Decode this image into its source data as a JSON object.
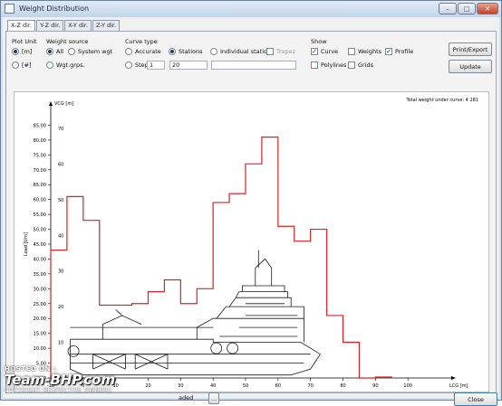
{
  "window": {
    "title": "Weight Distribution",
    "controls": [
      "–",
      "□",
      "✕"
    ]
  },
  "tabs": [
    "X-Z dir.",
    "Y-Z dir.",
    "X-Y dir.",
    "Z-Y dir."
  ],
  "plot_unit": {
    "title": "Plot Unit",
    "options": [
      "[m]",
      "[#]"
    ],
    "selected": "[m]"
  },
  "weight_source": {
    "title": "Weight source",
    "options": [
      "All",
      "System wgt",
      "Wgt.grps."
    ],
    "selected": "All"
  },
  "curve_type": {
    "title": "Curve type",
    "options": [
      "Accurate",
      "Stations",
      "Individual stations",
      "Tropez",
      "Step"
    ],
    "selected": "Stations",
    "step_value": "1",
    "stations_value": "20"
  },
  "show": {
    "title": "Show",
    "items": [
      {
        "label": "Curve",
        "checked": true
      },
      {
        "label": "Weights",
        "checked": false
      },
      {
        "label": "Profile",
        "checked": true
      },
      {
        "label": "Polylines",
        "checked": false
      },
      {
        "label": "Grids",
        "checked": false
      }
    ]
  },
  "buttons": {
    "print_export": "Print/Export",
    "update": "Update",
    "close": "Close",
    "ellipsis": "..."
  },
  "bottom": {
    "status_text": "aded"
  },
  "watermark": {
    "line1": "HOSTED ON :",
    "line2": "Team-BHP.com",
    "line3": "COPYRIGHT RESPECTIVE OWNERS"
  },
  "chart_data": {
    "type": "step-line",
    "total_text": "Total weight under curve: 4 281",
    "ylabel_top": "VCG [m]",
    "ylabel_left": "Load [t/m]",
    "xlabel": "LCG [m]",
    "xlim": [
      -10,
      110
    ],
    "ylim": [
      0,
      90
    ],
    "x_ticks": [
      "-10",
      "0",
      "10",
      "20",
      "30",
      "40",
      "50",
      "60",
      "70",
      "80",
      "90",
      "100"
    ],
    "y_ticks": [
      "0.00",
      "5.00",
      "10.00",
      "15.00",
      "20.00",
      "25.00",
      "30.00",
      "35.00",
      "40.00",
      "45.00",
      "50.00",
      "55.00",
      "60.00",
      "65.00",
      "70.00",
      "75.00",
      "80.00",
      "85.00"
    ],
    "vcg_ticks": [
      "10",
      "20",
      "30",
      "40",
      "50",
      "60",
      "70"
    ],
    "curve_color": "#e02020",
    "steps": [
      {
        "x0": -10,
        "x1": -5,
        "load": 43
      },
      {
        "x0": -5,
        "x1": 0,
        "load": 61
      },
      {
        "x0": 0,
        "x1": 5,
        "load": 53
      },
      {
        "x0": 5,
        "x1": 15,
        "load": 24.5
      },
      {
        "x0": 15,
        "x1": 20,
        "load": 25
      },
      {
        "x0": 20,
        "x1": 25,
        "load": 29
      },
      {
        "x0": 25,
        "x1": 30,
        "load": 33
      },
      {
        "x0": 30,
        "x1": 35,
        "load": 25
      },
      {
        "x0": 35,
        "x1": 40,
        "load": 30
      },
      {
        "x0": 40,
        "x1": 45,
        "load": 59
      },
      {
        "x0": 45,
        "x1": 50,
        "load": 62
      },
      {
        "x0": 50,
        "x1": 55,
        "load": 72
      },
      {
        "x0": 55,
        "x1": 60,
        "load": 81
      },
      {
        "x0": 60,
        "x1": 65,
        "load": 51
      },
      {
        "x0": 65,
        "x1": 70,
        "load": 46
      },
      {
        "x0": 70,
        "x1": 75,
        "load": 50
      },
      {
        "x0": 75,
        "x1": 80,
        "load": 21
      },
      {
        "x0": 80,
        "x1": 85,
        "load": 12
      },
      {
        "x0": 85,
        "x1": 90,
        "load": 0
      },
      {
        "x0": 90,
        "x1": 95,
        "load": 0.3
      }
    ]
  }
}
